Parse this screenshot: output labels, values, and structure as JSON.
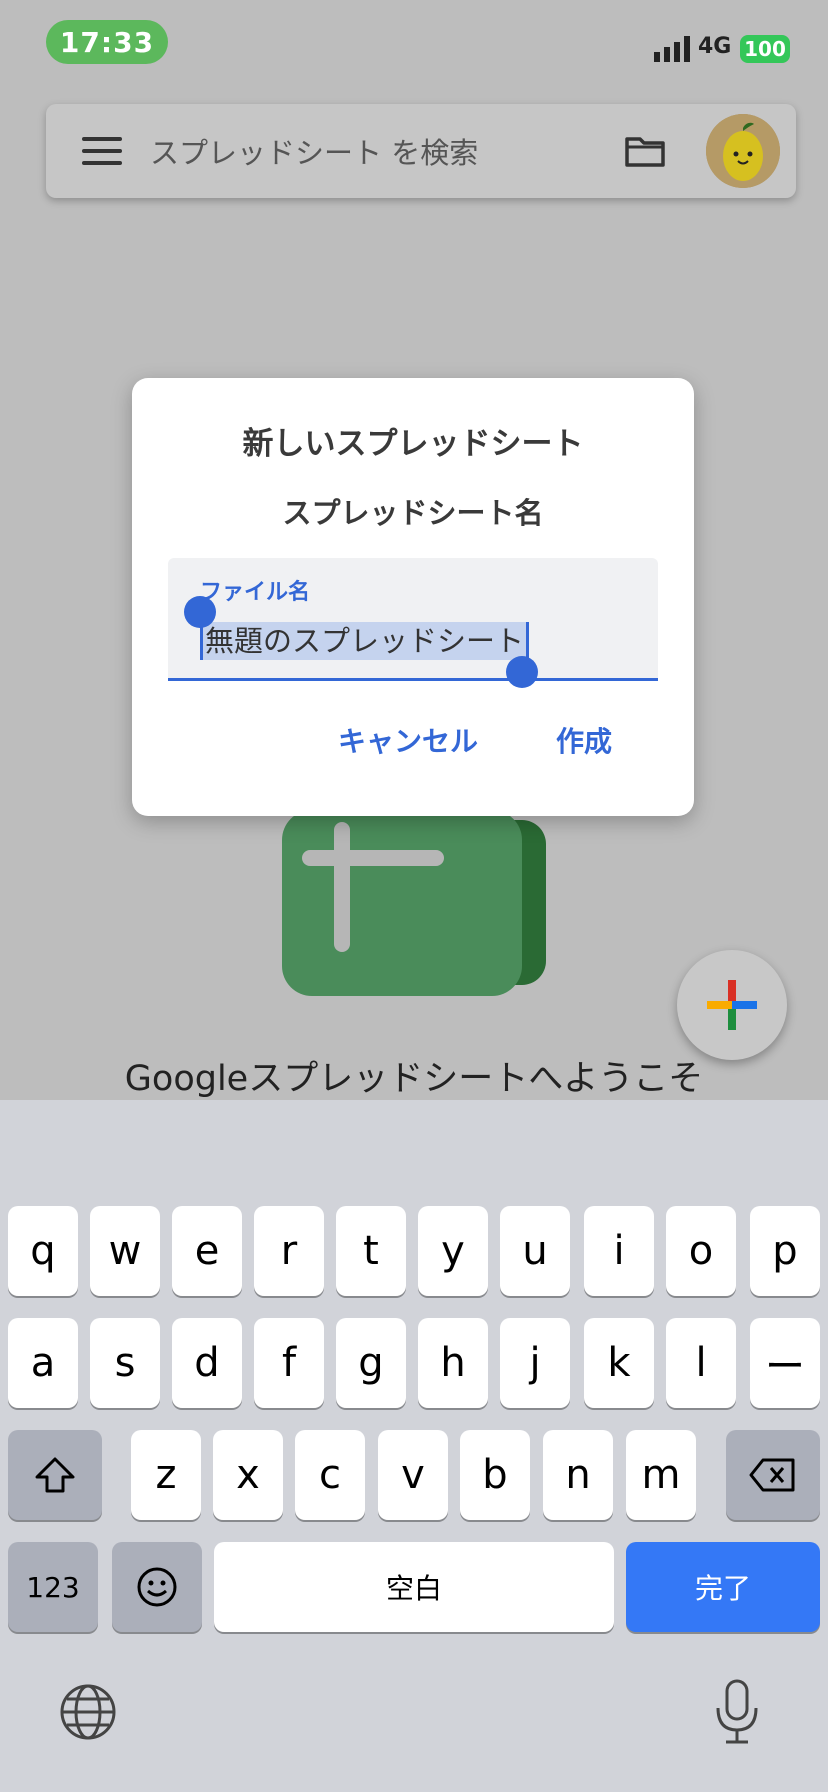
{
  "status_bar": {
    "time": "17:33",
    "network": "4G",
    "battery": "100"
  },
  "search_bar": {
    "placeholder": "スプレッドシート を検索"
  },
  "background": {
    "welcome": "Googleスプレッドシートへようこそ"
  },
  "dialog": {
    "title": "新しいスプレッドシート",
    "subtitle": "スプレッドシート名",
    "field_label": "ファイル名",
    "field_value": "無題のスプレッドシート",
    "cancel_label": "キャンセル",
    "create_label": "作成"
  },
  "keyboard": {
    "row1": [
      "q",
      "w",
      "e",
      "r",
      "t",
      "y",
      "u",
      "i",
      "o",
      "p"
    ],
    "row2": [
      "a",
      "s",
      "d",
      "f",
      "g",
      "h",
      "j",
      "k",
      "l",
      "ー"
    ],
    "row3": [
      "z",
      "x",
      "c",
      "v",
      "b",
      "n",
      "m"
    ],
    "numbers_label": "123",
    "space_label": "空白",
    "done_label": "完了"
  },
  "colors": {
    "accent": "#3367d6",
    "done_key": "#3478f6",
    "status_time_bg": "#5cb85c",
    "battery": "#34c759"
  }
}
